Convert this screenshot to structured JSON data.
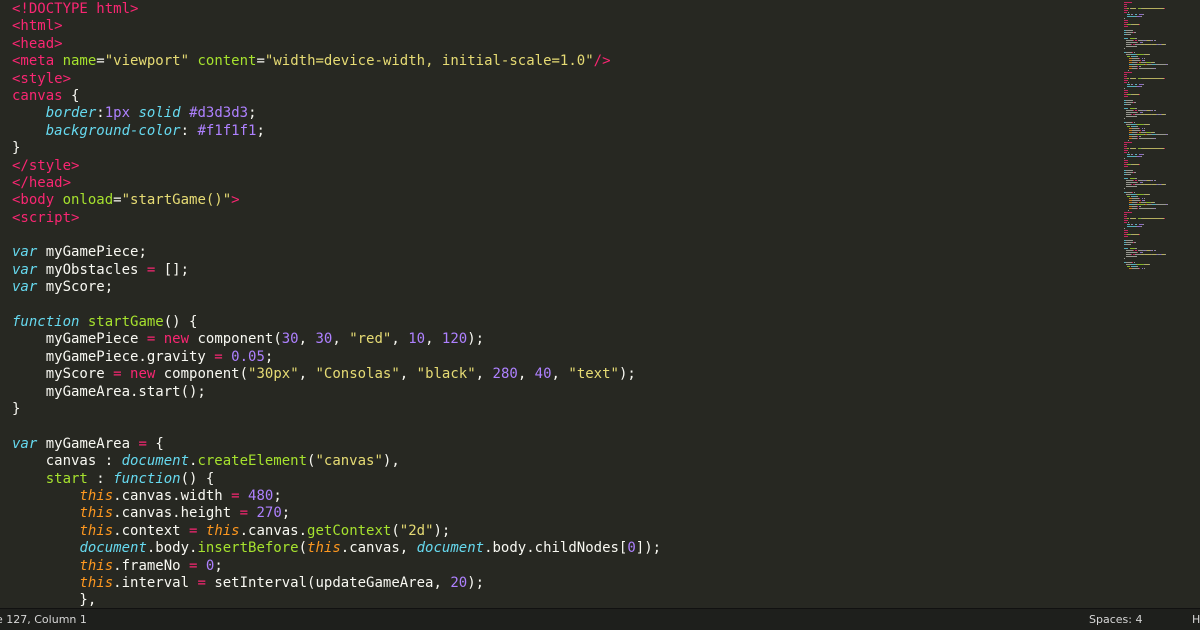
{
  "status": {
    "position": "e 127, Column 1",
    "indent": "Spaces: 4",
    "syntax": "H"
  },
  "theme": {
    "background": "#272822",
    "foreground": "#f8f8f2",
    "tag": "#f92672",
    "attribute": "#a6e22e",
    "string": "#e6db74",
    "number": "#ae81ff",
    "keyword": "#66d9ef",
    "this": "#fd971f",
    "statusbar": "#1e1f1c"
  },
  "code_lines": [
    [
      [
        "tag",
        "<!DOCTYPE html>"
      ]
    ],
    [
      [
        "tag",
        "<html>"
      ]
    ],
    [
      [
        "tag",
        "<head>"
      ]
    ],
    [
      [
        "tag",
        "<meta "
      ],
      [
        "attr",
        "name"
      ],
      [
        "plain",
        "="
      ],
      [
        "str",
        "\"viewport\""
      ],
      [
        "plain",
        " "
      ],
      [
        "attr",
        "content"
      ],
      [
        "plain",
        "="
      ],
      [
        "str",
        "\"width=device-width, initial-scale=1.0\""
      ],
      [
        "tag",
        "/>"
      ]
    ],
    [
      [
        "tag",
        "<style>"
      ]
    ],
    [
      [
        "sel",
        "canvas"
      ],
      [
        "plain",
        " {"
      ]
    ],
    [
      [
        "plain",
        "    "
      ],
      [
        "prop",
        "border"
      ],
      [
        "plain",
        ":"
      ],
      [
        "num",
        "1px"
      ],
      [
        "plain",
        " "
      ],
      [
        "prop",
        "solid"
      ],
      [
        "plain",
        " "
      ],
      [
        "num",
        "#d3d3d3"
      ],
      [
        "plain",
        ";"
      ]
    ],
    [
      [
        "plain",
        "    "
      ],
      [
        "prop",
        "background-color"
      ],
      [
        "plain",
        ": "
      ],
      [
        "num",
        "#f1f1f1"
      ],
      [
        "plain",
        ";"
      ]
    ],
    [
      [
        "plain",
        "}"
      ]
    ],
    [
      [
        "tag",
        "</style>"
      ]
    ],
    [
      [
        "tag",
        "</head>"
      ]
    ],
    [
      [
        "tag",
        "<body "
      ],
      [
        "attr",
        "onload"
      ],
      [
        "plain",
        "="
      ],
      [
        "str",
        "\"startGame()\""
      ],
      [
        "tag",
        ">"
      ]
    ],
    [
      [
        "tag",
        "<script>"
      ]
    ],
    [],
    [
      [
        "kw",
        "var"
      ],
      [
        "plain",
        " myGamePiece;"
      ]
    ],
    [
      [
        "kw",
        "var"
      ],
      [
        "plain",
        " myObstacles "
      ],
      [
        "op",
        "="
      ],
      [
        "plain",
        " [];"
      ]
    ],
    [
      [
        "kw",
        "var"
      ],
      [
        "plain",
        " myScore;"
      ]
    ],
    [],
    [
      [
        "kw",
        "function"
      ],
      [
        "plain",
        " "
      ],
      [
        "fn",
        "startGame"
      ],
      [
        "plain",
        "() {"
      ]
    ],
    [
      [
        "plain",
        "    myGamePiece "
      ],
      [
        "op",
        "="
      ],
      [
        "plain",
        " "
      ],
      [
        "op",
        "new"
      ],
      [
        "plain",
        " component("
      ],
      [
        "num",
        "30"
      ],
      [
        "plain",
        ", "
      ],
      [
        "num",
        "30"
      ],
      [
        "plain",
        ", "
      ],
      [
        "str",
        "\"red\""
      ],
      [
        "plain",
        ", "
      ],
      [
        "num",
        "10"
      ],
      [
        "plain",
        ", "
      ],
      [
        "num",
        "120"
      ],
      [
        "plain",
        ");"
      ]
    ],
    [
      [
        "plain",
        "    myGamePiece.gravity "
      ],
      [
        "op",
        "="
      ],
      [
        "plain",
        " "
      ],
      [
        "num",
        "0.05"
      ],
      [
        "plain",
        ";"
      ]
    ],
    [
      [
        "plain",
        "    myScore "
      ],
      [
        "op",
        "="
      ],
      [
        "plain",
        " "
      ],
      [
        "op",
        "new"
      ],
      [
        "plain",
        " component("
      ],
      [
        "str",
        "\"30px\""
      ],
      [
        "plain",
        ", "
      ],
      [
        "str",
        "\"Consolas\""
      ],
      [
        "plain",
        ", "
      ],
      [
        "str",
        "\"black\""
      ],
      [
        "plain",
        ", "
      ],
      [
        "num",
        "280"
      ],
      [
        "plain",
        ", "
      ],
      [
        "num",
        "40"
      ],
      [
        "plain",
        ", "
      ],
      [
        "str",
        "\"text\""
      ],
      [
        "plain",
        ");"
      ]
    ],
    [
      [
        "plain",
        "    myGameArea.start();"
      ]
    ],
    [
      [
        "plain",
        "}"
      ]
    ],
    [],
    [
      [
        "kw",
        "var"
      ],
      [
        "plain",
        " myGameArea "
      ],
      [
        "op",
        "="
      ],
      [
        "plain",
        " {"
      ]
    ],
    [
      [
        "plain",
        "    canvas : "
      ],
      [
        "obj",
        "document"
      ],
      [
        "plain",
        "."
      ],
      [
        "fn",
        "createElement"
      ],
      [
        "plain",
        "("
      ],
      [
        "str",
        "\"canvas\""
      ],
      [
        "plain",
        "),"
      ]
    ],
    [
      [
        "plain",
        "    "
      ],
      [
        "fn",
        "start"
      ],
      [
        "plain",
        " : "
      ],
      [
        "kw",
        "function"
      ],
      [
        "plain",
        "() {"
      ]
    ],
    [
      [
        "plain",
        "        "
      ],
      [
        "this",
        "this"
      ],
      [
        "plain",
        ".canvas.width "
      ],
      [
        "op",
        "="
      ],
      [
        "plain",
        " "
      ],
      [
        "num",
        "480"
      ],
      [
        "plain",
        ";"
      ]
    ],
    [
      [
        "plain",
        "        "
      ],
      [
        "this",
        "this"
      ],
      [
        "plain",
        ".canvas.height "
      ],
      [
        "op",
        "="
      ],
      [
        "plain",
        " "
      ],
      [
        "num",
        "270"
      ],
      [
        "plain",
        ";"
      ]
    ],
    [
      [
        "plain",
        "        "
      ],
      [
        "this",
        "this"
      ],
      [
        "plain",
        ".context "
      ],
      [
        "op",
        "="
      ],
      [
        "plain",
        " "
      ],
      [
        "this",
        "this"
      ],
      [
        "plain",
        ".canvas."
      ],
      [
        "fn",
        "getContext"
      ],
      [
        "plain",
        "("
      ],
      [
        "str",
        "\"2d\""
      ],
      [
        "plain",
        ");"
      ]
    ],
    [
      [
        "plain",
        "        "
      ],
      [
        "obj",
        "document"
      ],
      [
        "plain",
        ".body."
      ],
      [
        "fn",
        "insertBefore"
      ],
      [
        "plain",
        "("
      ],
      [
        "this",
        "this"
      ],
      [
        "plain",
        ".canvas, "
      ],
      [
        "obj",
        "document"
      ],
      [
        "plain",
        ".body.childNodes["
      ],
      [
        "num",
        "0"
      ],
      [
        "plain",
        "]);"
      ]
    ],
    [
      [
        "plain",
        "        "
      ],
      [
        "this",
        "this"
      ],
      [
        "plain",
        ".frameNo "
      ],
      [
        "op",
        "="
      ],
      [
        "plain",
        " "
      ],
      [
        "num",
        "0"
      ],
      [
        "plain",
        ";"
      ]
    ],
    [
      [
        "plain",
        "        "
      ],
      [
        "this",
        "this"
      ],
      [
        "plain",
        ".interval "
      ],
      [
        "op",
        "="
      ],
      [
        "plain",
        " setInterval(updateGameArea, "
      ],
      [
        "num",
        "20"
      ],
      [
        "plain",
        ");"
      ]
    ],
    [
      [
        "plain",
        "        },"
      ]
    ]
  ]
}
